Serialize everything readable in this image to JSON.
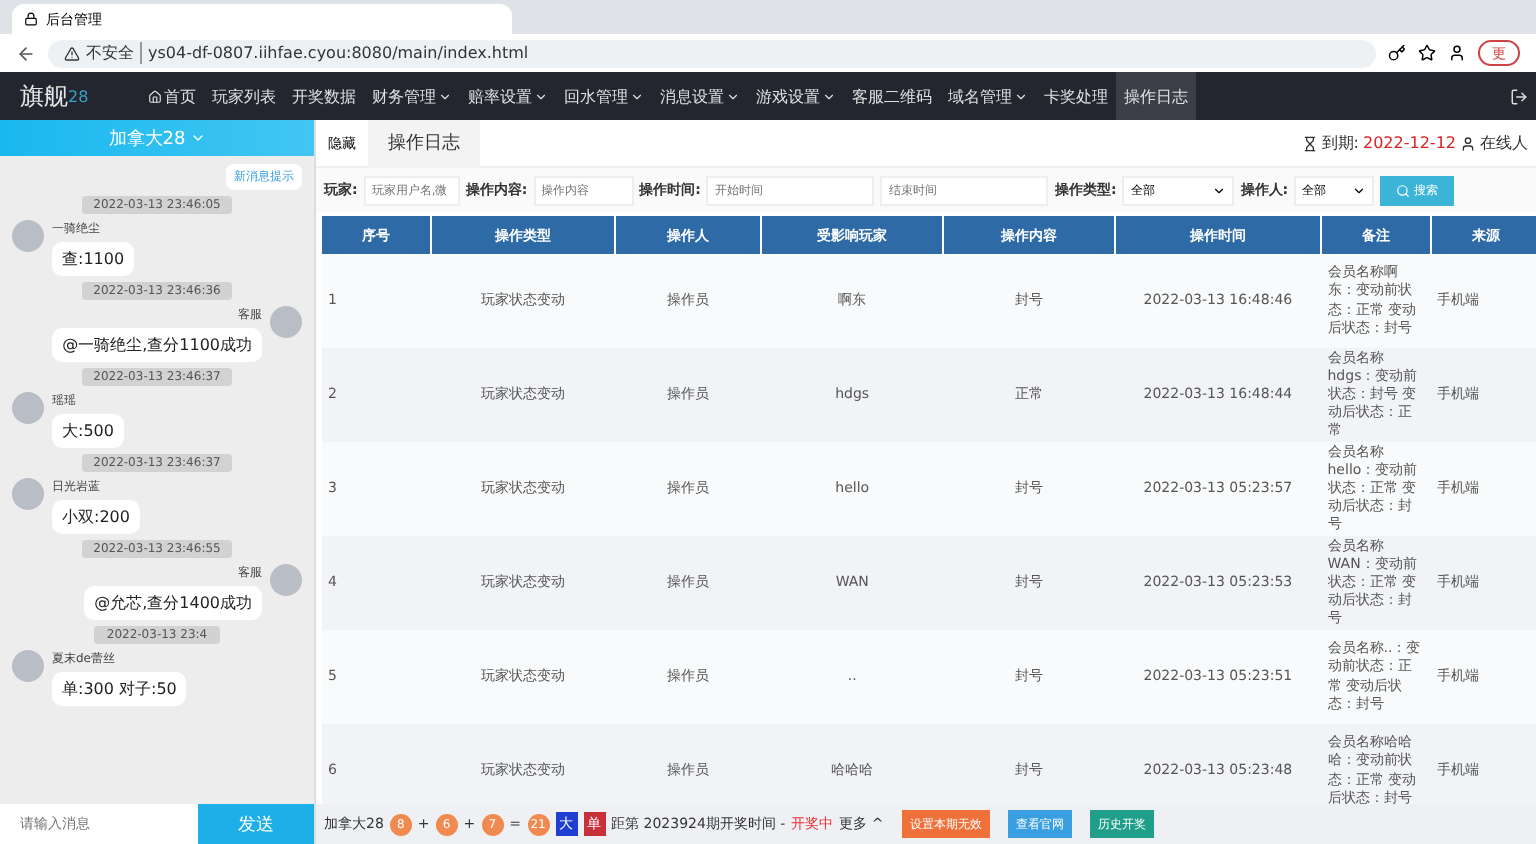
{
  "browser": {
    "tab_title": "后台管理",
    "security": "不安全",
    "url": "ys04-df-0807.iihfae.cyou:8080/main/index.html",
    "update_button": "更"
  },
  "navbar": {
    "logo": "旗舰",
    "logo_suffix": "28",
    "items": [
      {
        "label": "首页",
        "dropdown": false,
        "selected": false,
        "kind": "home"
      },
      {
        "label": "玩家列表",
        "dropdown": false,
        "selected": false,
        "kind": "plain"
      },
      {
        "label": "开奖数据",
        "dropdown": false,
        "selected": false,
        "kind": "plain"
      },
      {
        "label": "财务管理",
        "dropdown": true,
        "selected": false,
        "kind": "plain"
      },
      {
        "label": "赔率设置",
        "dropdown": true,
        "selected": false,
        "kind": "plain"
      },
      {
        "label": "回水管理",
        "dropdown": true,
        "selected": false,
        "kind": "plain"
      },
      {
        "label": "消息设置",
        "dropdown": true,
        "selected": false,
        "kind": "plain"
      },
      {
        "label": "游戏设置",
        "dropdown": true,
        "selected": false,
        "kind": "plain"
      },
      {
        "label": "客服二维码",
        "dropdown": false,
        "selected": false,
        "kind": "plain"
      },
      {
        "label": "域名管理",
        "dropdown": true,
        "selected": false,
        "kind": "plain"
      },
      {
        "label": "卡奖处理",
        "dropdown": false,
        "selected": false,
        "kind": "plain"
      },
      {
        "label": "操作日志",
        "dropdown": false,
        "selected": true,
        "kind": "plain"
      }
    ]
  },
  "chat": {
    "room": "加拿大28",
    "new_message_button": "新消息提示",
    "messages": [
      {
        "time": "2022-03-13 23:46:05",
        "sender": "一骑绝尘",
        "text": "查:1100",
        "kind": "received"
      },
      {
        "time": "2022-03-13 23:46:36",
        "sender": "客服",
        "text": "@一骑绝尘,查分1100成功",
        "kind": "sent"
      },
      {
        "time": "2022-03-13 23:46:37",
        "sender": "瑶瑶",
        "text": "大:500",
        "kind": "received"
      },
      {
        "time": "2022-03-13 23:46:37",
        "sender": "日光岩蓝",
        "text": "小双:200",
        "kind": "received"
      },
      {
        "time": "2022-03-13 23:46:55",
        "sender": "客服",
        "text": "@允芯,查分1400成功",
        "kind": "sent"
      },
      {
        "time": "2022-03-13 23:4",
        "sender": "夏末de蕾丝",
        "text": "单:300 对子:50",
        "kind": "received"
      }
    ],
    "input_placeholder": "请输入消息",
    "send_button": "发送"
  },
  "subbar": {
    "hide_button": "隐藏",
    "tab": "操作日志",
    "expiry_label": "到期:",
    "expiry_date": "2022-12-12",
    "online": "在线人"
  },
  "filters": {
    "player_label": "玩家:",
    "player_placeholder": "玩家用户名,微",
    "content_label": "操作内容:",
    "content_placeholder": "操作内容",
    "time_label": "操作时间:",
    "start_placeholder": "开始时间",
    "end_placeholder": "结束时间",
    "type_label": "操作类型:",
    "type_value": "全部",
    "operator_label": "操作人:",
    "operator_value": "全部",
    "search_button": "搜索"
  },
  "table": {
    "columns": [
      "序号",
      "操作类型",
      "操作人",
      "受影响玩家",
      "操作内容",
      "操作时间",
      "备注",
      "来源"
    ],
    "rows": [
      [
        "1",
        "玩家状态变动",
        "操作员",
        "啊东",
        "封号",
        "2022-03-13 16:48:46",
        "会员名称啊东：变动前状态：正常 变动后状态：封号",
        "手机端"
      ],
      [
        "2",
        "玩家状态变动",
        "操作员",
        "hdgs",
        "正常",
        "2022-03-13 16:48:44",
        "会员名称hdgs：变动前状态：封号 变动后状态：正常",
        "手机端"
      ],
      [
        "3",
        "玩家状态变动",
        "操作员",
        "hello",
        "封号",
        "2022-03-13 05:23:57",
        "会员名称hello：变动前状态：正常 变动后状态：封号",
        "手机端"
      ],
      [
        "4",
        "玩家状态变动",
        "操作员",
        "WAN",
        "封号",
        "2022-03-13 05:23:53",
        "会员名称WAN：变动前状态：正常 变动后状态：封号",
        "手机端"
      ],
      [
        "5",
        "玩家状态变动",
        "操作员",
        "..",
        "封号",
        "2022-03-13 05:23:51",
        "会员名称..：变动前状态：正常 变动后状态：封号",
        "手机端"
      ],
      [
        "6",
        "玩家状态变动",
        "操作员",
        "哈哈哈",
        "封号",
        "2022-03-13 05:23:48",
        "会员名称哈哈哈：变动前状态：正常 变动后状态：封号",
        "手机端"
      ]
    ]
  },
  "lottery_bar": {
    "game": "加拿大28",
    "balls": [
      "8",
      "6",
      "7"
    ],
    "plus": "+",
    "equals": "=",
    "sum": "21",
    "size_tag": "大",
    "parity_tag": "单",
    "countdown": "距第 2023924期开奖时间 - ",
    "status": "开奖中",
    "more": "更多 ^",
    "buttons": [
      {
        "label": "设置本期无效",
        "color": "#f0703a"
      },
      {
        "label": "查看官网",
        "color": "#3a9fe0"
      },
      {
        "label": "历史开奖",
        "color": "#1f9f8a"
      }
    ]
  }
}
